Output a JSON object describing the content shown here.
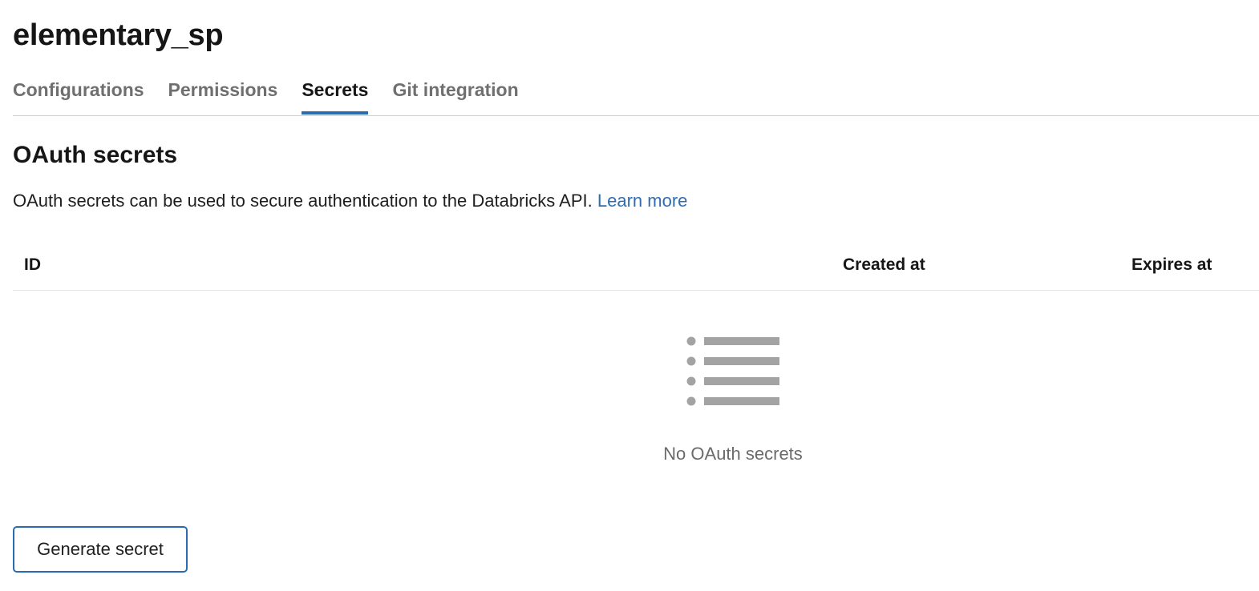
{
  "page": {
    "title": "elementary_sp"
  },
  "tabs": [
    {
      "label": "Configurations",
      "active": false
    },
    {
      "label": "Permissions",
      "active": false
    },
    {
      "label": "Secrets",
      "active": true
    },
    {
      "label": "Git integration",
      "active": false
    }
  ],
  "oauth": {
    "title": "OAuth secrets",
    "description": "OAuth secrets can be used to secure authentication to the Databricks API.",
    "learn_more": "Learn more"
  },
  "table": {
    "columns": [
      "ID",
      "Created at",
      "Expires at"
    ],
    "rows": [],
    "empty_icon": "list-icon",
    "empty_text": "No OAuth secrets"
  },
  "actions": {
    "generate_label": "Generate secret"
  },
  "colors": {
    "accent": "#2b6cb0",
    "link": "#2e6db4",
    "muted_text": "#6b6b6b",
    "icon_gray": "#a3a3a3"
  }
}
